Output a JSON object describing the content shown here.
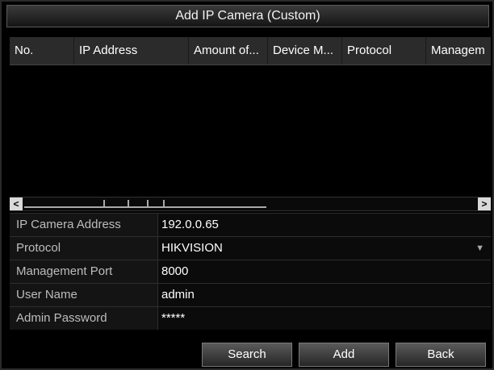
{
  "dialog": {
    "title": "Add IP Camera (Custom)"
  },
  "table": {
    "columns": [
      "No.",
      "IP Address",
      "Amount of...",
      "Device M...",
      "Protocol",
      "Managem"
    ],
    "rows": []
  },
  "form": {
    "ip_camera_address": {
      "label": "IP Camera Address",
      "value": "192.0.0.65"
    },
    "protocol": {
      "label": "Protocol",
      "value": "HIKVISION"
    },
    "management_port": {
      "label": "Management Port",
      "value": "8000"
    },
    "user_name": {
      "label": "User Name",
      "value": "admin"
    },
    "admin_password": {
      "label": "Admin Password",
      "value": "*****"
    }
  },
  "buttons": {
    "search": "Search",
    "add": "Add",
    "back": "Back"
  },
  "scrollbar": {
    "left_arrow": "<",
    "right_arrow": ">"
  },
  "icons": {
    "protocol_dropdown": "chevron-down-icon"
  }
}
